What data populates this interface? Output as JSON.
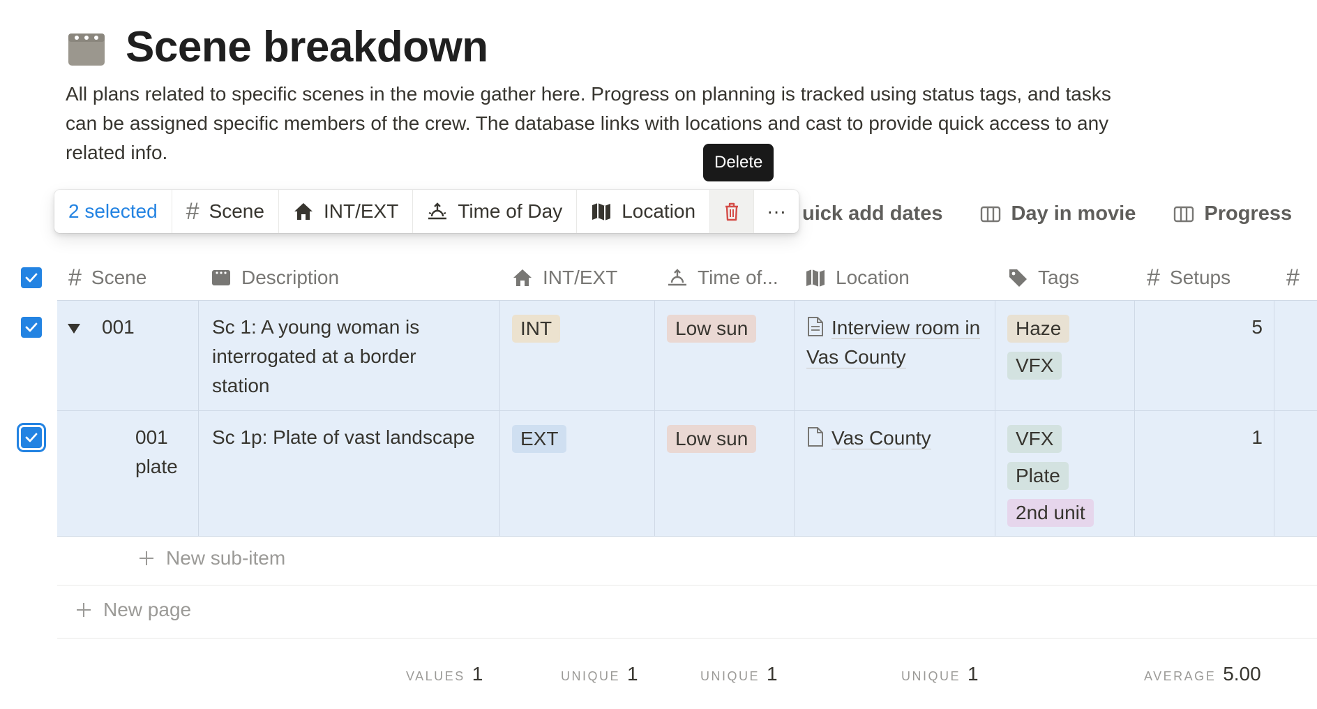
{
  "page": {
    "icon": "clapperboard-icon",
    "title": "Scene breakdown",
    "description": "All plans related to specific scenes in the movie gather here. Progress on planning is tracked using status tags, and tasks can be assigned specific members of the crew. The database links with locations and cast to provide quick access to any related info."
  },
  "view_actions": {
    "quick_add_dates": "uick add dates",
    "day_in_movie": "Day in movie",
    "progress": "Progress"
  },
  "toolbar": {
    "selected": "2 selected",
    "scene": "Scene",
    "int_ext": "INT/EXT",
    "time_of_day": "Time of Day",
    "location": "Location",
    "more": "···"
  },
  "tooltip": {
    "delete": "Delete"
  },
  "columns": {
    "scene": "Scene",
    "description": "Description",
    "int_ext": "INT/EXT",
    "time_of": "Time of...",
    "location": "Location",
    "tags": "Tags",
    "setups": "Setups",
    "extra": "#"
  },
  "rows": [
    {
      "scene": "001",
      "description": "Sc 1: A young woman is interrogated at a border station",
      "int_ext": "INT",
      "time_of_day": "Low sun",
      "location": "Interview room in Vas County",
      "tags": [
        "Haze",
        "VFX"
      ],
      "setups": "5",
      "checked": true,
      "expanded": true
    },
    {
      "scene": "001 plate",
      "description": "Sc 1p: Plate of vast landscape",
      "int_ext": "EXT",
      "time_of_day": "Low sun",
      "location": "Vas County",
      "tags": [
        "VFX",
        "Plate",
        "2nd unit"
      ],
      "setups": "1",
      "checked": true
    }
  ],
  "colors": {
    "accent": "#2383e2",
    "selected_row": "#e5eef9",
    "tag_haze": "#e8e1d3",
    "tag_vfx": "#d3e2e0",
    "tag_int": "#ece2cf",
    "tag_ext": "#cfdff1",
    "tag_low_sun": "#ead8d3",
    "tag_2nd_unit": "#e6d6ec",
    "delete_red": "#d44c47"
  },
  "actions": {
    "new_sub_item": "New sub-item",
    "new_page": "New page"
  },
  "calculations": [
    {
      "label": "VALUES",
      "value": "1"
    },
    {
      "label": "UNIQUE",
      "value": "1"
    },
    {
      "label": "UNIQUE",
      "value": "1"
    },
    {
      "label": "UNIQUE",
      "value": "1"
    },
    {
      "label": "AVERAGE",
      "value": "5.00"
    }
  ]
}
